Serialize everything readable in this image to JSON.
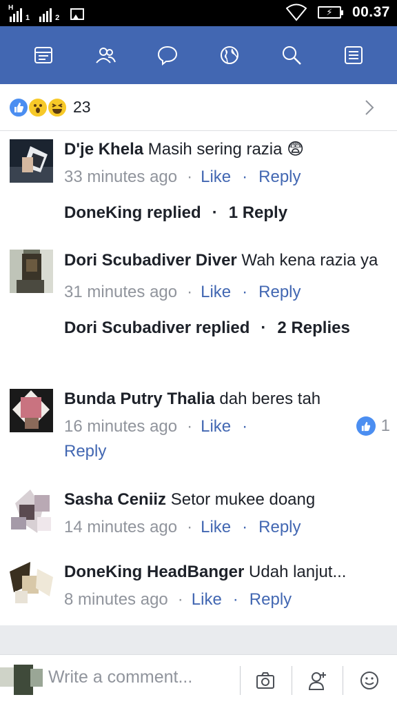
{
  "status_bar": {
    "sim1_label": "1",
    "sim2_label": "2",
    "network_letter": "H",
    "time": "00.37"
  },
  "nav": {
    "items": [
      {
        "icon": "news-feed-icon"
      },
      {
        "icon": "friends-icon"
      },
      {
        "icon": "messenger-icon"
      },
      {
        "icon": "globe-icon"
      },
      {
        "icon": "search-icon"
      },
      {
        "icon": "menu-icon"
      }
    ],
    "bar_color": "#4267b2"
  },
  "reactions": {
    "icons": [
      "like-icon",
      "wow-icon",
      "haha-icon"
    ],
    "count": "23"
  },
  "comments": [
    {
      "author": "D'je Khela",
      "text": " Masih sering razia 😨",
      "time": "33 minutes ago",
      "like_label": "Like",
      "reply_label": "Reply",
      "replies": {
        "by": "DoneKing replied",
        "count": "1 Reply"
      }
    },
    {
      "author": "Dori Scubadiver Diver",
      "text": " Wah kena razia ya",
      "time": "31 minutes ago",
      "like_label": "Like",
      "reply_label": "Reply",
      "replies": {
        "by": "Dori Scubadiver replied",
        "count": "2 Replies"
      }
    },
    {
      "author": "Bunda Putry Thalia",
      "text": " dah beres tah",
      "time": "16 minutes ago",
      "like_label": "Like",
      "reply_label": "Reply",
      "like_count": "1"
    },
    {
      "author": "Sasha Ceniiz",
      "text": " Setor mukee doang",
      "time": "14 minutes ago",
      "like_label": "Like",
      "reply_label": "Reply"
    },
    {
      "author": "DoneKing HeadBanger",
      "text": " Udah lanjut...",
      "time": "8 minutes ago",
      "like_label": "Like",
      "reply_label": "Reply"
    }
  ],
  "composer": {
    "placeholder": "Write a comment...",
    "buttons": [
      "camera-icon",
      "tag-friend-icon",
      "emoji-icon"
    ]
  },
  "colors": {
    "link": "#4267b2",
    "meta": "#90949c",
    "like_blue": "#4b8ef1"
  }
}
